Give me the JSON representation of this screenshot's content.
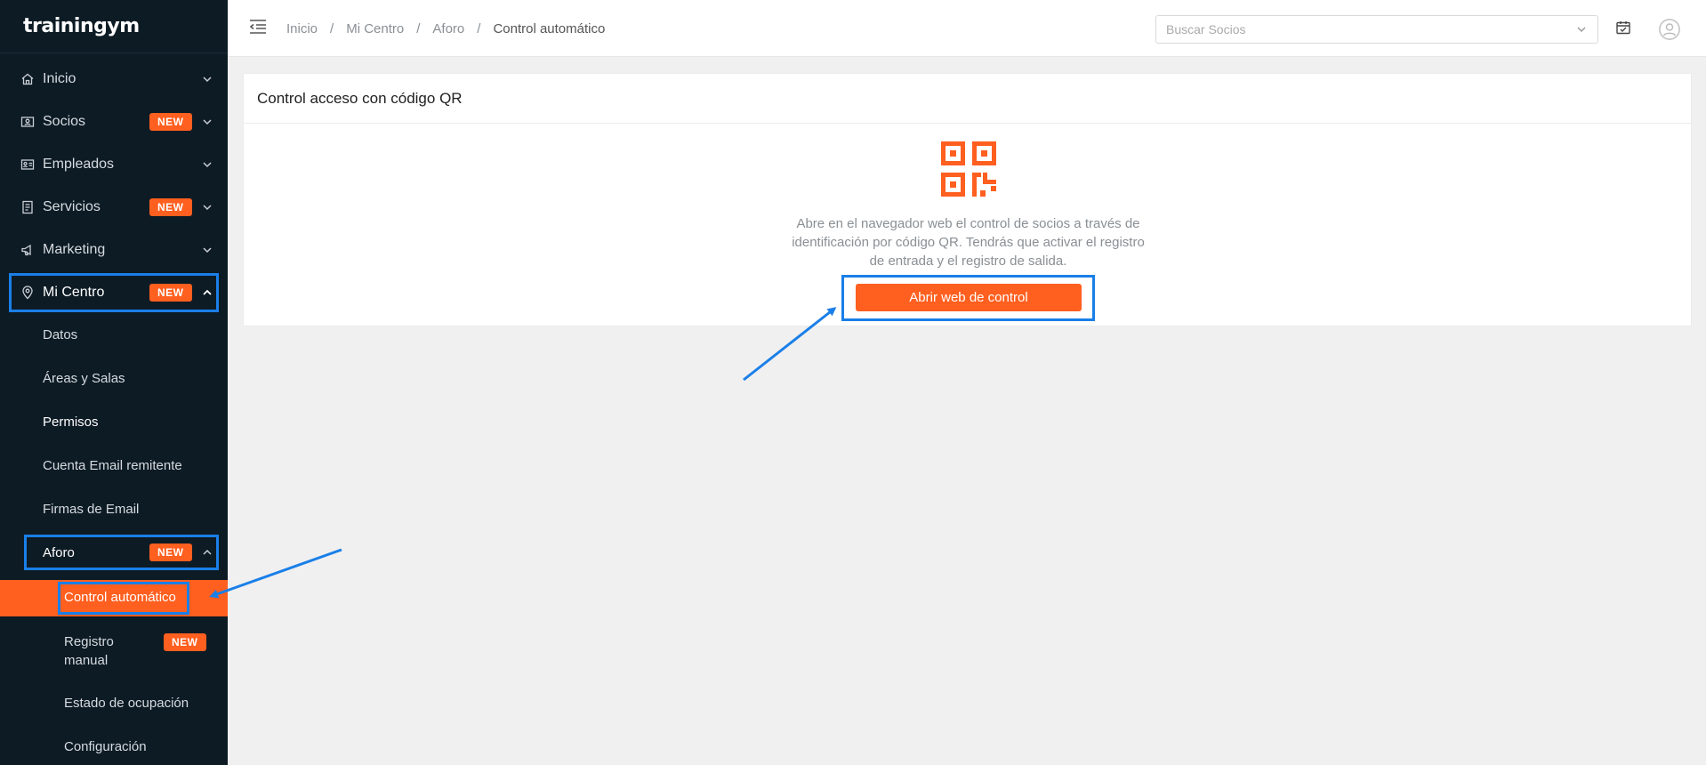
{
  "app": {
    "logo": "trainingym"
  },
  "sidebar": {
    "items": [
      {
        "label": "Inicio",
        "icon": "home-icon"
      },
      {
        "label": "Socios",
        "badge": "NEW",
        "icon": "member-card-icon"
      },
      {
        "label": "Empleados",
        "icon": "id-card-icon"
      },
      {
        "label": "Servicios",
        "badge": "NEW",
        "icon": "services-icon"
      },
      {
        "label": "Marketing",
        "icon": "megaphone-icon"
      },
      {
        "label": "Mi Centro",
        "badge": "NEW",
        "icon": "location-pin-icon",
        "expanded": true
      }
    ],
    "mi_centro_sub": [
      "Datos",
      "Áreas y Salas",
      "Permisos",
      "Cuenta Email remitente",
      "Firmas de Email"
    ],
    "aforo": {
      "label": "Aforo",
      "badge": "NEW"
    },
    "aforo_sub": {
      "control": "Control automático",
      "registro": "Registro manual",
      "registro_badge": "NEW",
      "estado": "Estado de ocupación",
      "config": "Configuración"
    }
  },
  "topbar": {
    "breadcrumb": [
      "Inicio",
      "Mi Centro",
      "Aforo",
      "Control automático"
    ],
    "separator": "/",
    "search_placeholder": "Buscar Socios"
  },
  "card": {
    "title": "Control acceso con código QR",
    "description": "Abre en el navegador web el control de socios a través de identificación por código QR. Tendrás que activar el registro de entrada y el registro de salida.",
    "button": "Abrir web de control"
  },
  "colors": {
    "accent": "#ff5f1f",
    "sidebar_bg": "#0d1b25",
    "highlight": "#1a7fe8"
  }
}
